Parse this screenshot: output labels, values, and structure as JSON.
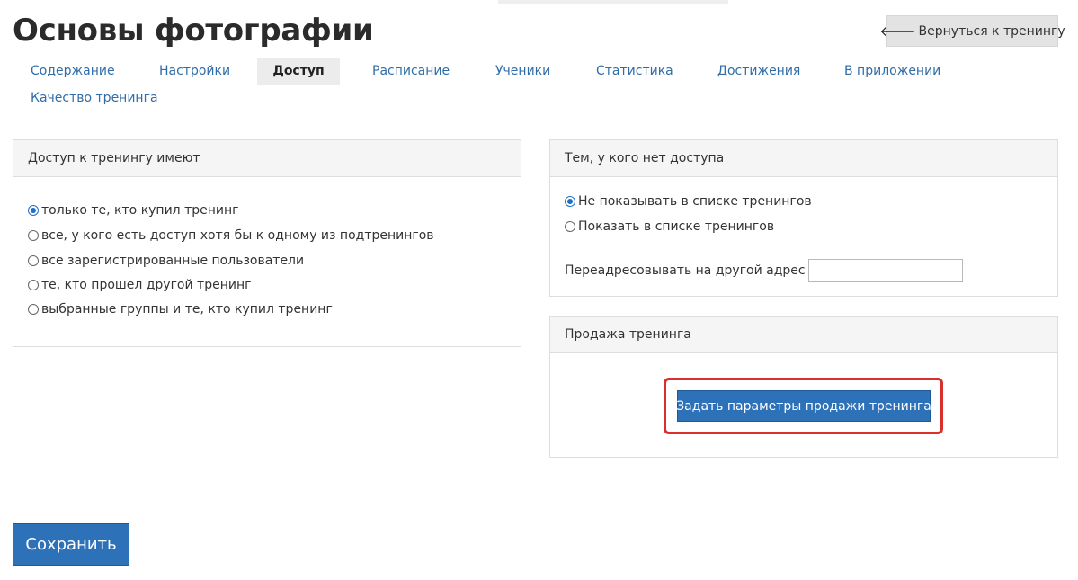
{
  "header": {
    "title": "Основы фотографии",
    "back_button_label": "Вернуться к тренингу",
    "back_icon": "arrow-left-icon"
  },
  "tabs": [
    {
      "label": "Содержание"
    },
    {
      "label": "Настройки"
    },
    {
      "label": "Доступ",
      "active": true
    },
    {
      "label": "Расписание"
    },
    {
      "label": "Ученики"
    },
    {
      "label": "Статистика"
    },
    {
      "label": "Достижения"
    },
    {
      "label": "В приложении"
    },
    {
      "label": "Качество тренинга"
    }
  ],
  "access_panel": {
    "title": "Доступ к тренингу имеют",
    "options": [
      {
        "label": "только те, кто купил тренинг",
        "checked": true
      },
      {
        "label": "все, у кого есть доступ хотя бы к одному из подтренингов",
        "checked": false
      },
      {
        "label": "все зарегистрированные пользователи",
        "checked": false
      },
      {
        "label": "те, кто прошел другой тренинг",
        "checked": false
      },
      {
        "label": "выбранные группы и те, кто купил тренинг",
        "checked": false
      }
    ]
  },
  "no_access_panel": {
    "title": "Тем, у кого нет доступа",
    "options": [
      {
        "label": "Не показывать в списке тренингов",
        "checked": true
      },
      {
        "label": "Показать в списке тренингов",
        "checked": false
      }
    ],
    "redirect_label": "Переадресовывать на другой адрес",
    "redirect_value": ""
  },
  "sale_panel": {
    "title": "Продажа тренинга",
    "button_label": "Задать параметры продажи тренинга",
    "highlight_color": "#d9302b"
  },
  "footer": {
    "save_label": "Сохранить"
  },
  "colors": {
    "primary_button": "#2d72b8",
    "link": "#2f6da8",
    "radio_checked": "#1a6fc9"
  }
}
